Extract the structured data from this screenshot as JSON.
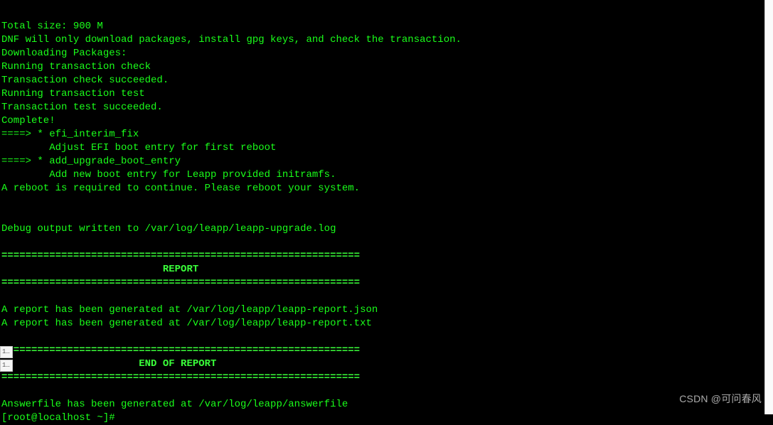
{
  "terminal": {
    "lines": [
      {
        "text": "Total size: 900 M",
        "class": "line"
      },
      {
        "text": "DNF will only download packages, install gpg keys, and check the transaction.",
        "class": "line"
      },
      {
        "text": "Downloading Packages:",
        "class": "line"
      },
      {
        "text": "Running transaction check",
        "class": "line"
      },
      {
        "text": "Transaction check succeeded.",
        "class": "line"
      },
      {
        "text": "Running transaction test",
        "class": "line"
      },
      {
        "text": "Transaction test succeeded.",
        "class": "line"
      },
      {
        "text": "Complete!",
        "class": "line"
      },
      {
        "text": "====> * efi_interim_fix",
        "class": "line"
      },
      {
        "text": "        Adjust EFI boot entry for first reboot",
        "class": "line"
      },
      {
        "text": "====> * add_upgrade_boot_entry",
        "class": "line"
      },
      {
        "text": "        Add new boot entry for Leapp provided initramfs.",
        "class": "line"
      },
      {
        "text": "A reboot is required to continue. Please reboot your system.",
        "class": "line"
      },
      {
        "text": "",
        "class": "line"
      },
      {
        "text": "",
        "class": "line"
      },
      {
        "text": "Debug output written to /var/log/leapp/leapp-upgrade.log",
        "class": "line"
      },
      {
        "text": "",
        "class": "line"
      },
      {
        "text": "============================================================",
        "class": "line bold"
      },
      {
        "text": "                           REPORT",
        "class": "line bold"
      },
      {
        "text": "============================================================",
        "class": "line bold"
      },
      {
        "text": "",
        "class": "line"
      },
      {
        "text": "A report has been generated at /var/log/leapp/leapp-report.json",
        "class": "line"
      },
      {
        "text": "A report has been generated at /var/log/leapp/leapp-report.txt",
        "class": "line"
      },
      {
        "text": "",
        "class": "line"
      },
      {
        "text": "============================================================",
        "class": "line bold"
      },
      {
        "text": "                       END OF REPORT",
        "class": "line bold"
      },
      {
        "text": "============================================================",
        "class": "line bold"
      },
      {
        "text": "",
        "class": "line"
      },
      {
        "text": "Answerfile has been generated at /var/log/leapp/answerfile",
        "class": "line"
      },
      {
        "text": "[root@localhost ~]#",
        "class": "line"
      }
    ]
  },
  "tabs": {
    "tab1": "1…",
    "tab2": "1…"
  },
  "watermark": "CSDN @可问春风"
}
